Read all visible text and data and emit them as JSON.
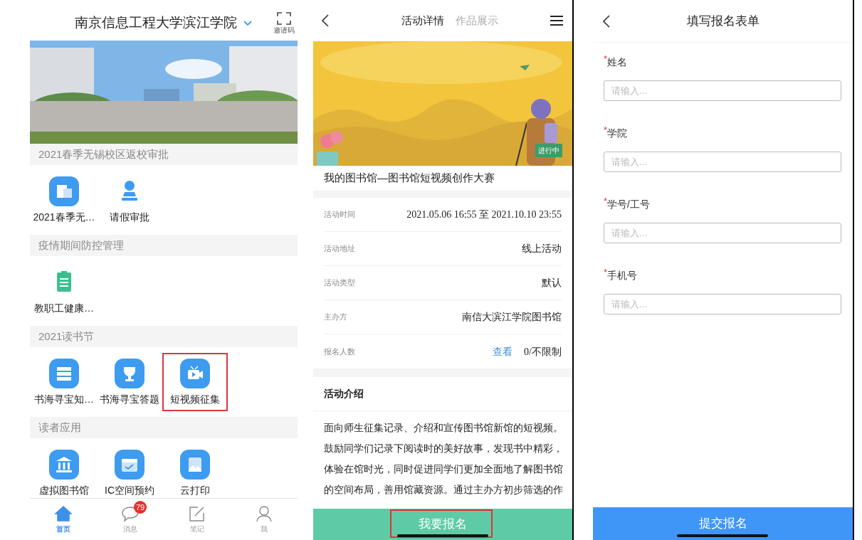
{
  "home": {
    "title": "南京信息工程大学滨江学院",
    "scan_label": "邀请码",
    "sections": [
      {
        "title": "2021春季无锡校区返校审批",
        "apps": [
          {
            "label": "2021春季无…",
            "kind": "tile",
            "highlighted": false
          },
          {
            "label": "请假审批",
            "kind": "plain",
            "highlighted": false
          }
        ]
      },
      {
        "title": "疫情期间防控管理",
        "apps": [
          {
            "label": "教职工健康…",
            "kind": "plain",
            "highlighted": false
          }
        ]
      },
      {
        "title": "2021读书节",
        "apps": [
          {
            "label": "书海寻宝知…",
            "kind": "tile",
            "highlighted": false
          },
          {
            "label": "书海寻宝答题",
            "kind": "tile",
            "highlighted": false
          },
          {
            "label": "短视频征集",
            "kind": "tile",
            "highlighted": true
          }
        ]
      },
      {
        "title": "读者应用",
        "apps": [
          {
            "label": "虚拟图书馆",
            "kind": "tile",
            "highlighted": false
          },
          {
            "label": "IC空间预约",
            "kind": "tile",
            "highlighted": false
          },
          {
            "label": "云打印",
            "kind": "tile",
            "highlighted": false
          }
        ]
      }
    ],
    "tab_bar": [
      {
        "label": "首页",
        "selected": true
      },
      {
        "label": "消息",
        "selected": false,
        "badge": "79"
      },
      {
        "label": "笔记",
        "selected": false
      },
      {
        "label": "我",
        "selected": false
      }
    ]
  },
  "detail": {
    "tabs": [
      {
        "label": "活动详情",
        "selected": true
      },
      {
        "label": "作品展示",
        "selected": false
      }
    ],
    "banner": {
      "kind": "picture",
      "status": "进行中"
    },
    "title": "我的图书馆—图书馆短视频创作大赛",
    "info_rows": [
      {
        "label": "活动时间",
        "value": "2021.05.06 16:55 至 2021.10.10 23:55",
        "kind": "serif"
      },
      {
        "label": "活动地址",
        "value": "线上活动",
        "kind": "plain"
      },
      {
        "label": "活动类型",
        "value": "默认",
        "kind": "plain"
      },
      {
        "label": "主办方",
        "value": "南信大滨江学院图书馆",
        "kind": "plain"
      },
      {
        "label": "报名人数",
        "link": "查看",
        "value": "0/不限制",
        "kind": "serif"
      }
    ],
    "intro_title": "活动介绍",
    "intro": "面向师生征集记录、介绍和宣传图书馆新馆的短视频。鼓励同学们记录下阅读时的美好故事，发现书中精彩，体验在馆时光，同时促进同学们更加全面地了解图书馆的空间布局，善用馆藏资源。通过主办方初步筛选的作",
    "signup_button": {
      "label": "我要报名",
      "highlighted": true
    }
  },
  "form": {
    "title": "填写报名表单",
    "fields": [
      {
        "mark": "*",
        "label": "姓名",
        "placeholder": "请输入..."
      },
      {
        "mark": "*",
        "label": "学院",
        "placeholder": "请输入..."
      },
      {
        "mark": "*",
        "label": "学号/工号",
        "placeholder": "请输入..."
      },
      {
        "mark": "*",
        "label": "手机号",
        "placeholder": "请输入..."
      }
    ],
    "submit_button": "提交报名"
  }
}
